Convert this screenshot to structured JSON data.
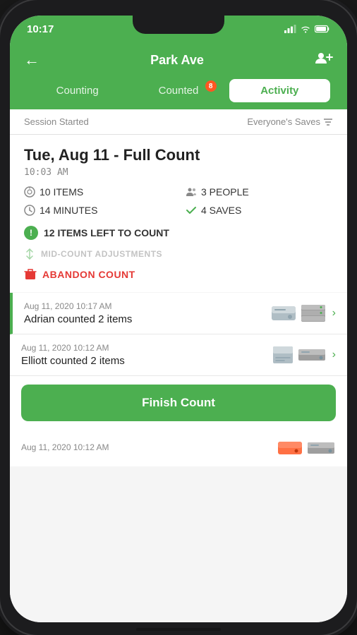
{
  "status_bar": {
    "time": "10:17",
    "signal": "▲",
    "wifi": "WiFi",
    "battery": "Battery"
  },
  "header": {
    "back_label": "←",
    "title": "Park Ave",
    "add_user_label": "👥"
  },
  "tabs": [
    {
      "id": "counting",
      "label": "Counting",
      "active": false,
      "badge": null
    },
    {
      "id": "counted",
      "label": "Counted",
      "active": false,
      "badge": "8"
    },
    {
      "id": "activity",
      "label": "Activity",
      "active": true,
      "badge": null
    }
  ],
  "session": {
    "started_label": "Session Started",
    "everyone_saves_label": "Everyone's Saves"
  },
  "count_card": {
    "title": "Tue, Aug 11 - Full Count",
    "time": "10:03 AM",
    "stats": [
      {
        "icon": "clock",
        "value": "10 ITEMS"
      },
      {
        "icon": "person",
        "value": "3 PEOPLE"
      },
      {
        "icon": "clock",
        "value": "14 MINUTES"
      },
      {
        "icon": "check",
        "value": "4 SAVES"
      }
    ],
    "alert_items_left": "12 ITEMS LEFT TO COUNT",
    "mid_count_label": "MID-COUNT ADJUSTMENTS",
    "abandon_label": "ABANDON COUNT"
  },
  "activity_items": [
    {
      "timestamp": "Aug 11, 2020 10:17 AM",
      "description": "Adrian counted 2 items",
      "highlighted": true,
      "thumbs": [
        "hdd1",
        "server1"
      ]
    },
    {
      "timestamp": "Aug 11, 2020 10:12 AM",
      "description": "Elliott counted 2 items",
      "highlighted": false,
      "thumbs": [
        "card1",
        "ssd1"
      ]
    }
  ],
  "finish_button": {
    "label": "Finish Count"
  },
  "partial_item": {
    "timestamp": "Aug 11, 2020 10:12 AM",
    "thumbs": [
      "orange1",
      "ssd2"
    ]
  }
}
